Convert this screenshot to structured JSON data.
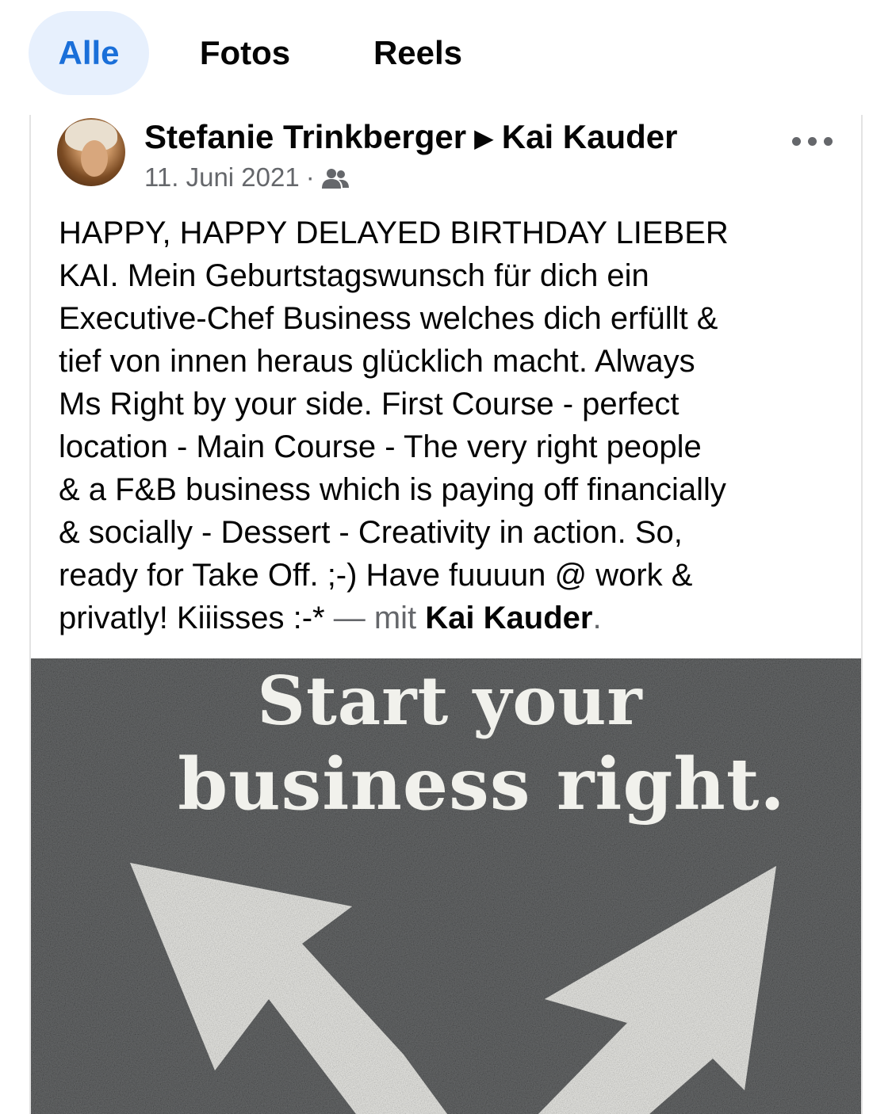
{
  "tabs": [
    {
      "label": "Alle",
      "active": true
    },
    {
      "label": "Fotos",
      "active": false
    },
    {
      "label": "Reels",
      "active": false
    }
  ],
  "post": {
    "author": "Stefanie Trinkberger",
    "recipient": "Kai Kauder",
    "date": "11. Juni 2021",
    "separator": "·",
    "audience_icon": "friends-icon",
    "more_icon": "more-horizontal-icon",
    "text_lines": [
      "HAPPY, HAPPY DELAYED BIRTHDAY LIEBER",
      "KAI. Mein Geburtstagswunsch für dich ein",
      "Executive-Chef Business welches dich erfüllt &",
      "tief von innen heraus glücklich macht. Always",
      "Ms Right by your side. First Course - perfect",
      "location - Main Course - The very right people",
      "& a F&B business which is paying off financially",
      "& socially - Dessert - Creativity in action. So,",
      "ready for Take Off. ;-) Have fuuuun @ work &"
    ],
    "text_last_line": "privatly! Kiiisses :-*",
    "with_prefix": " — mit ",
    "tagged_person": "Kai Kauder",
    "tag_suffix": ".",
    "photo": {
      "line1": "Start your",
      "line2": "business right."
    }
  },
  "colors": {
    "active_tab_bg": "#e7f0fd",
    "active_tab_text": "#1a6fd9",
    "secondary_text": "#65676b",
    "asphalt": "#5b5d5e",
    "paint": "#f1f1ec"
  }
}
